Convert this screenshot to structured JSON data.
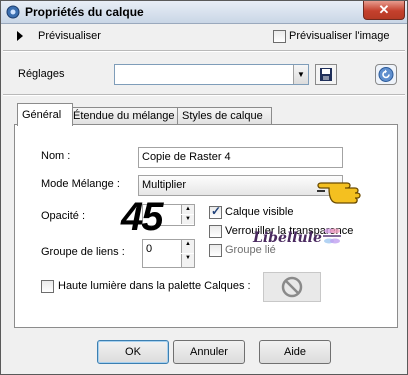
{
  "window": {
    "title": "Propriétés du calque",
    "close_label": "✕"
  },
  "preview": {
    "label": "Prévisualiser",
    "image_label": "Prévisualiser l'image",
    "image_checked": false
  },
  "presets": {
    "label": "Réglages",
    "value": ""
  },
  "tabs": [
    {
      "label": "Général",
      "active": true
    },
    {
      "label": "Étendue du mélange",
      "active": false
    },
    {
      "label": "Styles de calque",
      "active": false
    }
  ],
  "general": {
    "name_label": "Nom :",
    "name_value": "Copie de Raster 4",
    "blend_label": "Mode Mélange :",
    "blend_value": "Multiplier",
    "opacity_label": "Opacité :",
    "opacity_value": "45",
    "visible_label": "Calque visible",
    "visible_checked": true,
    "lock_label": "Verrouiller la transparence",
    "lock_checked": false,
    "group_label": "Groupe de liens :",
    "group_value": "0",
    "group_check_label": "Groupe lié",
    "group_checked": false,
    "highlight_label": "Haute lumière dans la palette Calques :",
    "highlight_checked": false
  },
  "watermark": "Libellule",
  "buttons": {
    "ok": "OK",
    "cancel": "Annuler",
    "help": "Aide"
  },
  "colors": {
    "accent": "#3c7fb1",
    "hand": "#f4c020"
  }
}
